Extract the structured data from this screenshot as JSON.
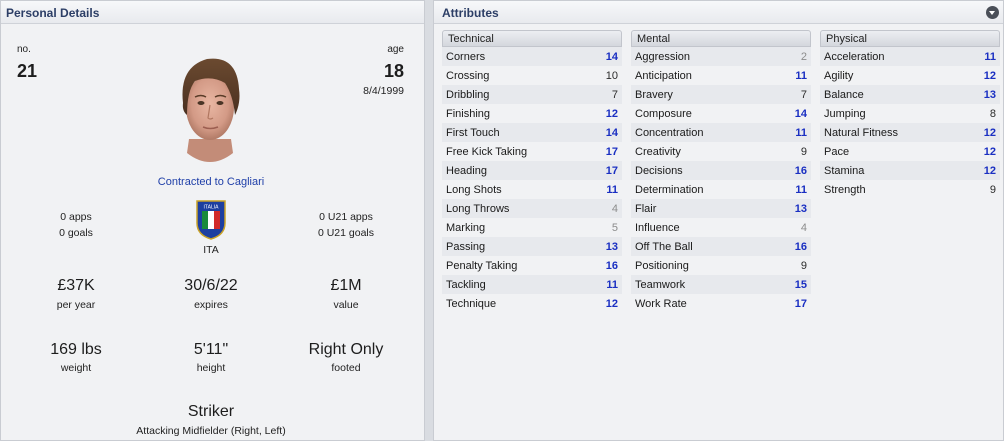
{
  "personal": {
    "title": "Personal Details",
    "number_label": "no.",
    "number": "21",
    "age_label": "age",
    "age": "18",
    "dob": "8/4/1999",
    "contract": "Contracted to Cagliari",
    "apps": "0 apps",
    "goals": "0 goals",
    "nation_code": "ITA",
    "nation_badge_text": "ITALIA",
    "u21_apps": "0 U21 apps",
    "u21_goals": "0 U21 goals",
    "wage": "£37K",
    "wage_label": "per year",
    "expires": "30/6/22",
    "expires_label": "expires",
    "value": "£1M",
    "value_label": "value",
    "weight": "169 lbs",
    "weight_label": "weight",
    "height": "5'11\"",
    "height_label": "height",
    "foot": "Right Only",
    "foot_label": "footed",
    "position": "Striker",
    "secondary_position": "Attacking Midfielder (Right, Left)"
  },
  "attributes": {
    "title": "Attributes",
    "columns": [
      {
        "name": "Technical",
        "items": [
          {
            "label": "Corners",
            "value": "14"
          },
          {
            "label": "Crossing",
            "value": "10"
          },
          {
            "label": "Dribbling",
            "value": "7"
          },
          {
            "label": "Finishing",
            "value": "12"
          },
          {
            "label": "First Touch",
            "value": "14"
          },
          {
            "label": "Free Kick Taking",
            "value": "17"
          },
          {
            "label": "Heading",
            "value": "17"
          },
          {
            "label": "Long Shots",
            "value": "11"
          },
          {
            "label": "Long Throws",
            "value": "4"
          },
          {
            "label": "Marking",
            "value": "5"
          },
          {
            "label": "Passing",
            "value": "13"
          },
          {
            "label": "Penalty Taking",
            "value": "16"
          },
          {
            "label": "Tackling",
            "value": "11"
          },
          {
            "label": "Technique",
            "value": "12"
          }
        ]
      },
      {
        "name": "Mental",
        "items": [
          {
            "label": "Aggression",
            "value": "2"
          },
          {
            "label": "Anticipation",
            "value": "11"
          },
          {
            "label": "Bravery",
            "value": "7"
          },
          {
            "label": "Composure",
            "value": "14"
          },
          {
            "label": "Concentration",
            "value": "11"
          },
          {
            "label": "Creativity",
            "value": "9"
          },
          {
            "label": "Decisions",
            "value": "16"
          },
          {
            "label": "Determination",
            "value": "11"
          },
          {
            "label": "Flair",
            "value": "13"
          },
          {
            "label": "Influence",
            "value": "4"
          },
          {
            "label": "Off The Ball",
            "value": "16"
          },
          {
            "label": "Positioning",
            "value": "9"
          },
          {
            "label": "Teamwork",
            "value": "15"
          },
          {
            "label": "Work Rate",
            "value": "17"
          }
        ]
      },
      {
        "name": "Physical",
        "items": [
          {
            "label": "Acceleration",
            "value": "11"
          },
          {
            "label": "Agility",
            "value": "12"
          },
          {
            "label": "Balance",
            "value": "13"
          },
          {
            "label": "Jumping",
            "value": "8"
          },
          {
            "label": "Natural Fitness",
            "value": "12"
          },
          {
            "label": "Pace",
            "value": "12"
          },
          {
            "label": "Stamina",
            "value": "12"
          },
          {
            "label": "Strength",
            "value": "9"
          }
        ]
      }
    ]
  }
}
